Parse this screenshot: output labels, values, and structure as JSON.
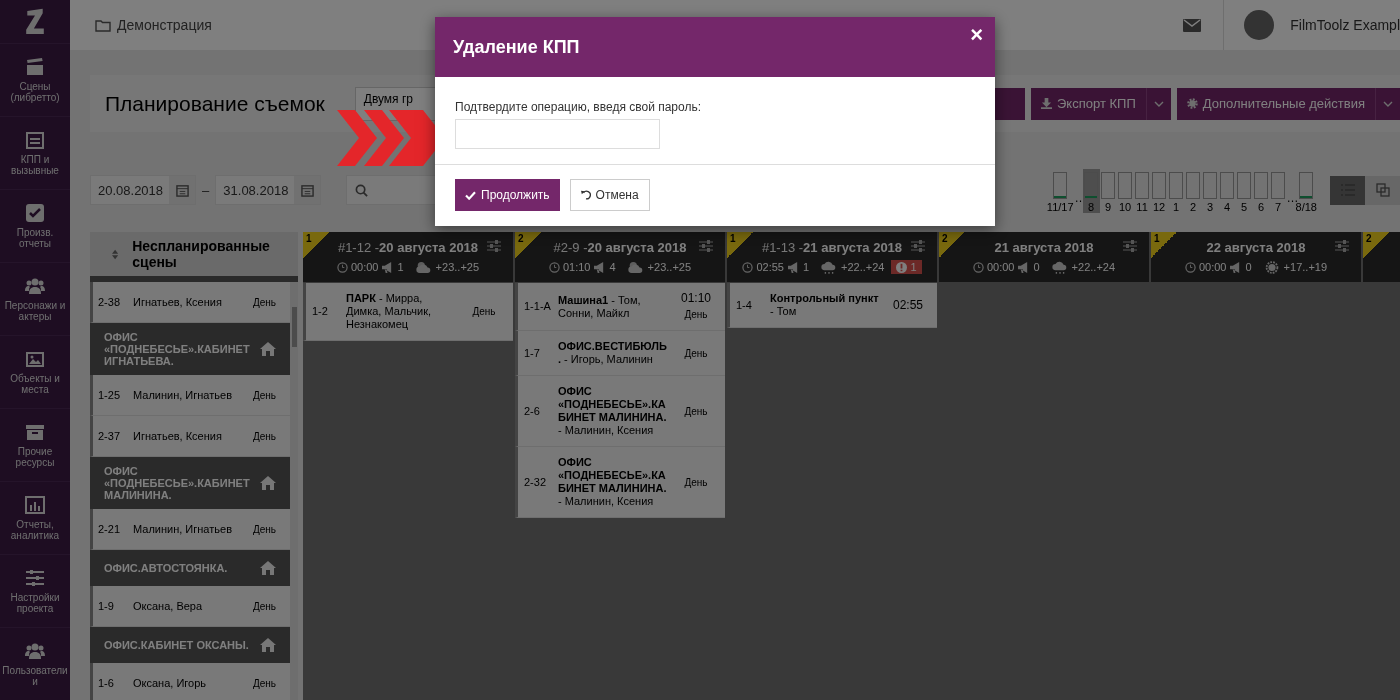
{
  "sidebar": {
    "items": [
      {
        "label": "Сцены (либретто)"
      },
      {
        "label": "КПП и вызывные"
      },
      {
        "label": "Произв. отчеты"
      },
      {
        "label": "Персонажи и актеры"
      },
      {
        "label": "Объекты и места"
      },
      {
        "label": "Прочие ресурсы"
      },
      {
        "label": "Отчеты, аналитика"
      },
      {
        "label": "Настройки проекта"
      },
      {
        "label": "Пользователи и"
      }
    ]
  },
  "topbar": {
    "breadcrumb": "Демонстрация",
    "user_name": "FilmToolz Exampl"
  },
  "header": {
    "title": "Планирование съемок",
    "view_select": "Двумя гр",
    "buttons": [
      {
        "label": "Экспорт КПП"
      },
      {
        "label": "Дополнительные действия"
      }
    ]
  },
  "filters": {
    "date_from": "20.08.2018",
    "separator": "–",
    "date_to": "31.08.2018"
  },
  "hours": [
    {
      "label": "11/17",
      "level": 0.06,
      "selected": false,
      "ellipsis_after": "…"
    },
    {
      "label": "8",
      "level": 0.06,
      "selected": true
    },
    {
      "label": "9",
      "selected": false
    },
    {
      "label": "10",
      "selected": false
    },
    {
      "label": "11",
      "selected": false
    },
    {
      "label": "12",
      "selected": false
    },
    {
      "label": "1",
      "selected": false
    },
    {
      "label": "2",
      "selected": false
    },
    {
      "label": "3",
      "selected": false
    },
    {
      "label": "4",
      "selected": false
    },
    {
      "label": "5",
      "selected": false
    },
    {
      "label": "6",
      "selected": false
    },
    {
      "label": "7",
      "selected": false,
      "ellipsis_after": "…"
    },
    {
      "label": "8/18",
      "level": 0.06,
      "selected": false
    }
  ],
  "view_toggle": [
    {
      "kind": "list",
      "selected": true
    },
    {
      "kind": "cards",
      "selected": false
    }
  ],
  "unplanned": {
    "title": "Неспланированные сцены",
    "items": [
      {
        "kind": "scene",
        "number": "2-38",
        "cast": "Игнатьев, Ксения",
        "time_of_day": "День"
      },
      {
        "kind": "location",
        "title": "ОФИС «ПОДНЕБЕСЬЕ».КАБИНЕТ ИГНАТЬЕВА."
      },
      {
        "kind": "scene",
        "number": "1-25",
        "cast": "Малинин, Игнатьев",
        "time_of_day": "День"
      },
      {
        "kind": "scene",
        "number": "2-37",
        "cast": "Игнатьев, Ксения",
        "time_of_day": "День"
      },
      {
        "kind": "location",
        "title": "ОФИС «ПОДНЕБЕСЬЕ».КАБИНЕТ МАЛИНИНА."
      },
      {
        "kind": "scene",
        "number": "2-21",
        "cast": "Малинин, Игнатьев",
        "time_of_day": "День"
      },
      {
        "kind": "location",
        "title": "ОФИС.АВТОСТОЯНКА."
      },
      {
        "kind": "scene",
        "number": "1-9",
        "cast": "Оксана, Вера",
        "time_of_day": "День"
      },
      {
        "kind": "location",
        "title": "ОФИС.КАБИНЕТ ОКСАНЫ."
      },
      {
        "kind": "scene",
        "number": "1-6",
        "cast": "Оксана, Игорь",
        "time_of_day": "День"
      }
    ]
  },
  "columns": [
    {
      "badge": "1",
      "code": "#1-12 -",
      "date": "20 августа 2018",
      "time": "00:00",
      "extras": "1",
      "weather": {
        "kind": "partly-cloudy",
        "temp": "+23..+25"
      },
      "scenes": [
        {
          "number": "1-2",
          "text": "**ПАРК** - Мирра, Димка, Мальчик, Незнакомец",
          "time_of_day": "День"
        }
      ]
    },
    {
      "badge": "2",
      "code": "#2-9 -",
      "date": "20 августа 2018",
      "time": "01:10",
      "extras": "4",
      "weather": {
        "kind": "partly-cloudy",
        "temp": "+23..+25"
      },
      "scenes": [
        {
          "number": "1-1-A",
          "text": "**Машина1** - Том, Сонни, Майкл",
          "time": "01:10",
          "time_of_day": "День"
        },
        {
          "number": "1-7",
          "text": "**ОФИС.ВЕСТИБЮЛЬ.** - Игорь, Малинин",
          "time_of_day": "День"
        },
        {
          "number": "2-6",
          "text": "**ОФИС «ПОДНЕБЕСЬЕ».КАБИНЕТ МАЛИНИНА.** - Малинин, Ксения",
          "time_of_day": "День"
        },
        {
          "number": "2-32",
          "text": "**ОФИС «ПОДНЕБЕСЬЕ».КАБИНЕТ МАЛИНИНА.** - Малинин, Ксения",
          "time_of_day": "День"
        }
      ]
    },
    {
      "badge": "1",
      "code": "#1-13 -",
      "date": "21 августа 2018",
      "time": "02:55",
      "extras": "1",
      "weather": {
        "kind": "rain",
        "temp": "+22..+24"
      },
      "alert": "1",
      "scenes": [
        {
          "number": "1-4",
          "text": "**Контрольный пункт** - Том",
          "time": "02:55"
        }
      ]
    },
    {
      "badge": "2",
      "date": "21 августа 2018",
      "time": "00:00",
      "extras": "0",
      "weather": {
        "kind": "rain",
        "temp": "+22..+24"
      }
    },
    {
      "badge": "1",
      "date": "22 августа 2018",
      "time": "00:00",
      "extras": "0",
      "weather": {
        "kind": "sun",
        "temp": "+17..+19"
      }
    },
    {
      "badge": "2"
    }
  ],
  "modal": {
    "title": "Удаление КПП",
    "close": "×",
    "prompt": "Подтвердите операцию, введя свой пароль:",
    "buttons": [
      {
        "kind": "primary",
        "label": "Продолжить"
      },
      {
        "kind": "secondary",
        "label": "Отмена"
      }
    ]
  }
}
